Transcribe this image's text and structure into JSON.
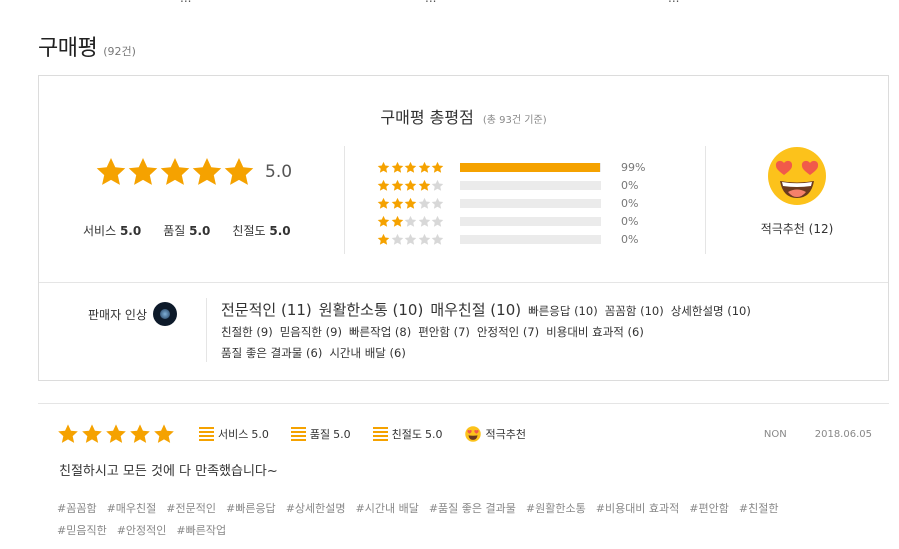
{
  "top_fragments": [
    "...",
    "...",
    "..."
  ],
  "heading": {
    "title": "구매평",
    "count": "(92건)"
  },
  "summary": {
    "title": "구매평 총평점",
    "subtitle": "(총 93건 기준)",
    "rating": 5,
    "rating_text": "5.0",
    "sub_scores": [
      {
        "label": "서비스",
        "value": "5.0"
      },
      {
        "label": "품질",
        "value": "5.0"
      },
      {
        "label": "친절도",
        "value": "5.0"
      }
    ],
    "distribution": [
      {
        "stars": 5,
        "percent": 99,
        "label": "99%"
      },
      {
        "stars": 4,
        "percent": 0,
        "label": "0%"
      },
      {
        "stars": 3,
        "percent": 0,
        "label": "0%"
      },
      {
        "stars": 2,
        "percent": 0,
        "label": "0%"
      },
      {
        "stars": 1,
        "percent": 0,
        "label": "0%"
      }
    ],
    "recommend": {
      "icon": "heart-eyes-emoji-icon",
      "label": "적극추천 (12)"
    }
  },
  "impressions": {
    "label": "판매자 인상",
    "tags": [
      {
        "text": "전문적인 (11)",
        "size": "big"
      },
      {
        "text": "원활한소통 (10)",
        "size": "big"
      },
      {
        "text": "매우친절 (10)",
        "size": "big"
      },
      {
        "text": "빠른응답 (10)",
        "size": "small"
      },
      {
        "text": "꼼꼼함 (10)",
        "size": "small"
      },
      {
        "text": "상세한설명 (10)",
        "size": "small"
      },
      {
        "text": "친절한 (9)",
        "size": "small"
      },
      {
        "text": "믿음직한 (9)",
        "size": "small"
      },
      {
        "text": "빠른작업 (8)",
        "size": "small"
      },
      {
        "text": "편안함 (7)",
        "size": "small"
      },
      {
        "text": "안정적인 (7)",
        "size": "small"
      },
      {
        "text": "비용대비 효과적 (6)",
        "size": "small"
      },
      {
        "text": "품질 좋은 결과물 (6)",
        "size": "small"
      },
      {
        "text": "시간내 배달 (6)",
        "size": "small"
      }
    ]
  },
  "review": {
    "stars": 5,
    "items": [
      {
        "label": "서비스",
        "value": "5.0"
      },
      {
        "label": "품질",
        "value": "5.0"
      },
      {
        "label": "친절도",
        "value": "5.0"
      }
    ],
    "recommend": "적극추천",
    "author": "NON",
    "date": "2018.06.05",
    "text": "친절하시고 모든 것에 다 만족했습니다~",
    "hashtags": [
      "#꼼꼼함",
      "#매우친절",
      "#전문적인",
      "#빠른응답",
      "#상세한설명",
      "#시간내 배달",
      "#품질 좋은 결과물",
      "#원활한소통",
      "#비용대비 효과적",
      "#편안함",
      "#친절한",
      "#믿음직한",
      "#안정적인",
      "#빠른작업"
    ]
  },
  "colors": {
    "star": "#f5a200",
    "star_empty": "#d8d8d8",
    "bar_empty": "#ebebeb"
  }
}
